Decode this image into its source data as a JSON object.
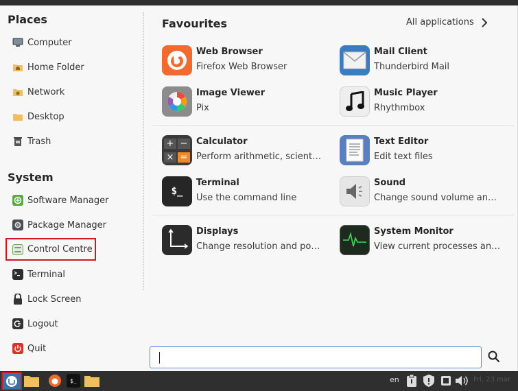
{
  "places": {
    "title": "Places",
    "items": [
      {
        "label": "Computer",
        "icon": "computer-icon"
      },
      {
        "label": "Home Folder",
        "icon": "home-folder-icon"
      },
      {
        "label": "Network",
        "icon": "network-folder-icon"
      },
      {
        "label": "Desktop",
        "icon": "desktop-folder-icon"
      },
      {
        "label": "Trash",
        "icon": "trash-icon"
      }
    ]
  },
  "system": {
    "title": "System",
    "items": [
      {
        "label": "Software Manager",
        "icon": "software-manager-icon"
      },
      {
        "label": "Package Manager",
        "icon": "package-manager-icon"
      },
      {
        "label": "Control Centre",
        "icon": "control-centre-icon"
      },
      {
        "label": "Terminal",
        "icon": "terminal-icon"
      },
      {
        "label": "Lock Screen",
        "icon": "lock-icon"
      },
      {
        "label": "Logout",
        "icon": "logout-icon"
      },
      {
        "label": "Quit",
        "icon": "power-icon"
      }
    ]
  },
  "favourites": {
    "title": "Favourites",
    "all_apps_label": "All applications",
    "apps": [
      {
        "name": "Web Browser",
        "desc": "Firefox Web Browser",
        "icon": "firefox-icon"
      },
      {
        "name": "Mail Client",
        "desc": "Thunderbird Mail",
        "icon": "mail-icon"
      },
      {
        "name": "Image Viewer",
        "desc": "Pix",
        "icon": "image-viewer-icon"
      },
      {
        "name": "Music Player",
        "desc": "Rhythmbox",
        "icon": "music-icon"
      },
      {
        "name": "Calculator",
        "desc": "Perform arithmetic, scientific or financial calculations",
        "icon": "calculator-icon"
      },
      {
        "name": "Text Editor",
        "desc": "Edit text files",
        "icon": "text-editor-icon"
      },
      {
        "name": "Terminal",
        "desc": "Use the command line",
        "icon": "terminal-icon"
      },
      {
        "name": "Sound",
        "desc": "Change sound volume and sound events",
        "icon": "sound-icon"
      },
      {
        "name": "Displays",
        "desc": "Change resolution and position of monitors",
        "icon": "displays-icon"
      },
      {
        "name": "System Monitor",
        "desc": "View current processes and monitor system state",
        "icon": "system-monitor-icon"
      }
    ]
  },
  "search": {
    "value": ""
  },
  "taskbar": {
    "language": "en",
    "clock": "Fri, 23 mar"
  }
}
